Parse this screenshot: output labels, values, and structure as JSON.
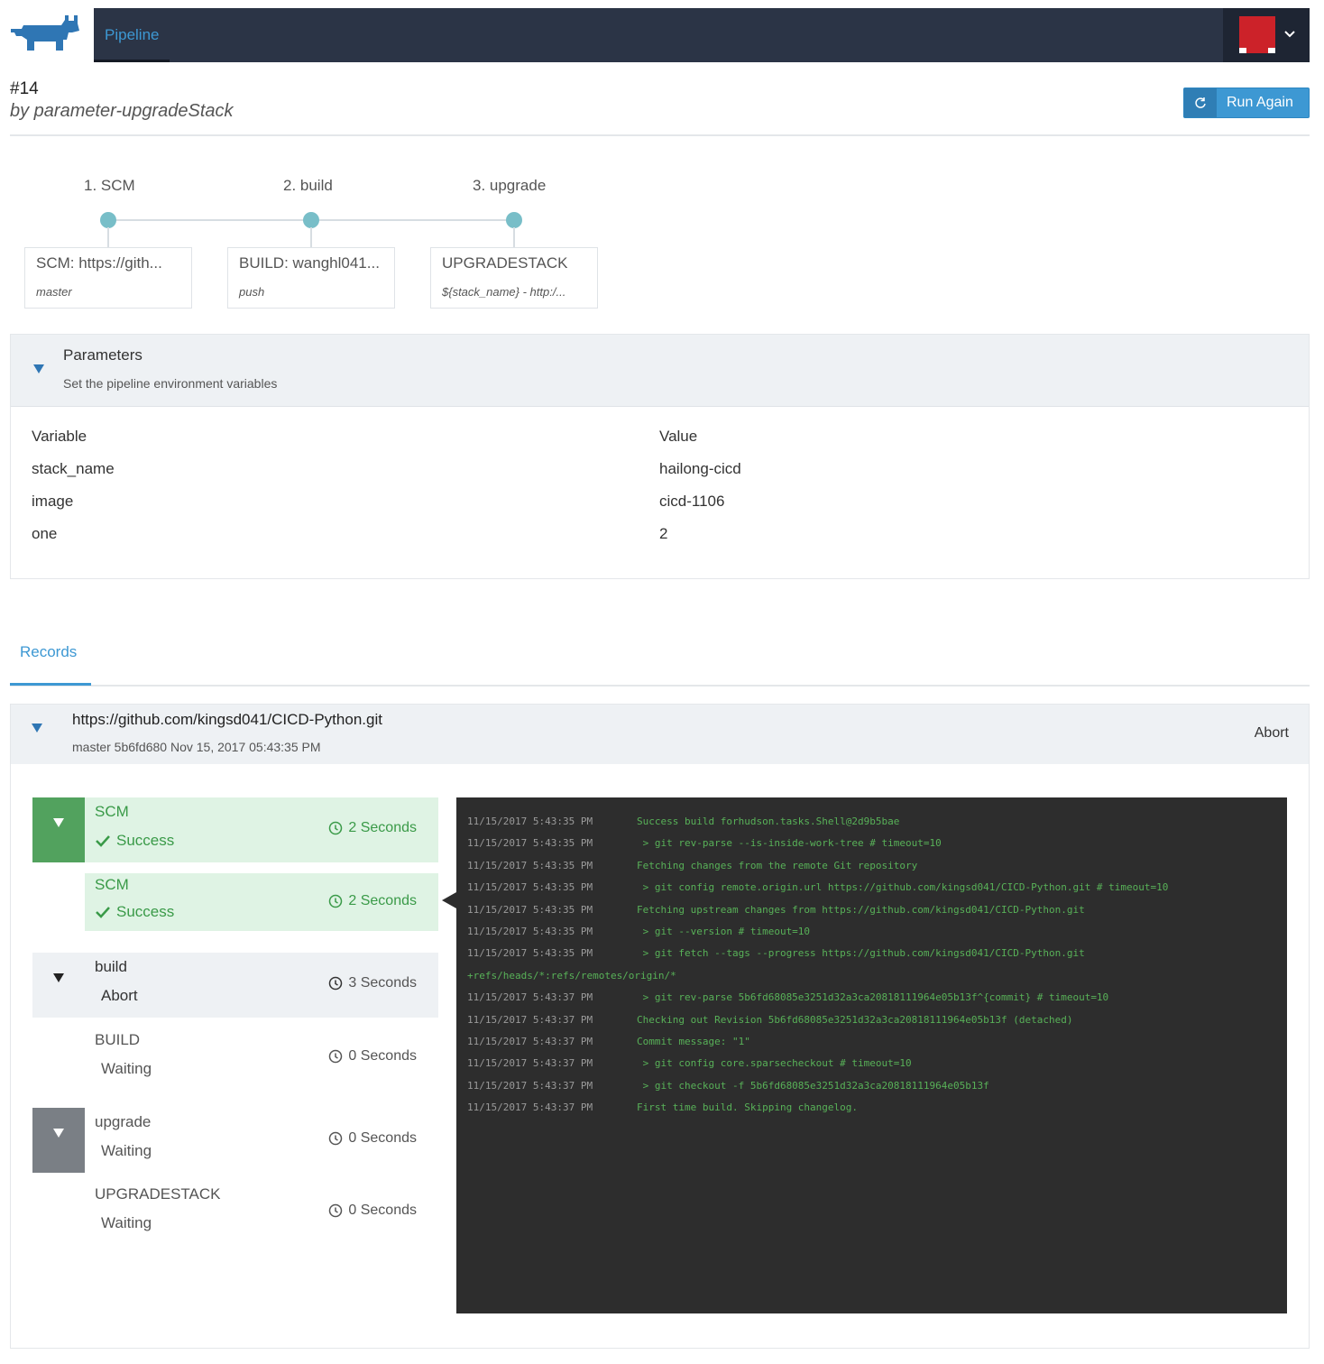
{
  "header": {
    "logo_icon": "rancher-cow-logo",
    "tab_label": "Pipeline",
    "user_menu_icon": "chevron-down-icon",
    "brand_color": "#3d98d3"
  },
  "run": {
    "number": "#14",
    "by": "by parameter-upgradeStack",
    "run_again_label": "Run Again",
    "run_again_icon": "refresh-icon"
  },
  "stages": [
    {
      "title": "1. SCM",
      "card_name": "SCM: https://gith...",
      "card_sub": "master"
    },
    {
      "title": "2. build",
      "card_name": "BUILD: wanghl041...",
      "card_sub": "push"
    },
    {
      "title": "3. upgrade",
      "card_name": "UPGRADESTACK",
      "card_sub": "${stack_name} - http:/..."
    }
  ],
  "parameters": {
    "title": "Parameters",
    "description": "Set the pipeline environment variables",
    "header_key": "Variable",
    "header_value": "Value",
    "rows": [
      {
        "key": "stack_name",
        "value": "hailong-cicd"
      },
      {
        "key": "image",
        "value": "cicd-1106"
      },
      {
        "key": "one",
        "value": "2"
      }
    ]
  },
  "records": {
    "tab_label": "Records",
    "record": {
      "repo": "https://github.com/kingsd041/CICD-Python.git",
      "meta": "master 5b6fd680 Nov 15, 2017 05:43:35 PM",
      "abort_label": "Abort"
    },
    "steps": [
      {
        "name": "SCM",
        "status": "Success",
        "duration": "2 Seconds"
      },
      {
        "name": "SCM",
        "status": "Success",
        "duration": "2 Seconds"
      },
      {
        "name": "build",
        "status": "Abort",
        "duration": "3 Seconds"
      },
      {
        "name": "BUILD",
        "status": "Waiting",
        "duration": "0 Seconds"
      },
      {
        "name": "upgrade",
        "status": "Waiting",
        "duration": "0 Seconds"
      },
      {
        "name": "UPGRADESTACK",
        "status": "Waiting",
        "duration": "0 Seconds"
      }
    ]
  },
  "log": [
    {
      "ts": "11/15/2017 5:43:35 PM",
      "msg": "Success build forhudson.tasks.Shell@2d9b5bae"
    },
    {
      "ts": "11/15/2017 5:43:35 PM",
      "msg": " > git rev-parse --is-inside-work-tree # timeout=10"
    },
    {
      "ts": "11/15/2017 5:43:35 PM",
      "msg": "Fetching changes from the remote Git repository"
    },
    {
      "ts": "11/15/2017 5:43:35 PM",
      "msg": " > git config remote.origin.url https://github.com/kingsd041/CICD-Python.git # timeout=10"
    },
    {
      "ts": "11/15/2017 5:43:35 PM",
      "msg": "Fetching upstream changes from https://github.com/kingsd041/CICD-Python.git"
    },
    {
      "ts": "11/15/2017 5:43:35 PM",
      "msg": " > git --version # timeout=10"
    },
    {
      "ts": "11/15/2017 5:43:35 PM",
      "msg": " > git fetch --tags --progress https://github.com/kingsd041/CICD-Python.git"
    },
    {
      "ts": "",
      "msg": "+refs/heads/*:refs/remotes/origin/*"
    },
    {
      "ts": "11/15/2017 5:43:37 PM",
      "msg": " > git rev-parse 5b6fd68085e3251d32a3ca20818111964e05b13f^{commit} # timeout=10"
    },
    {
      "ts": "11/15/2017 5:43:37 PM",
      "msg": "Checking out Revision 5b6fd68085e3251d32a3ca20818111964e05b13f (detached)"
    },
    {
      "ts": "11/15/2017 5:43:37 PM",
      "msg": "Commit message: \"1\""
    },
    {
      "ts": "11/15/2017 5:43:37 PM",
      "msg": " > git config core.sparsecheckout # timeout=10"
    },
    {
      "ts": "11/15/2017 5:43:37 PM",
      "msg": " > git checkout -f 5b6fd68085e3251d32a3ca20818111964e05b13f"
    },
    {
      "ts": "11/15/2017 5:43:37 PM",
      "msg": "First time build. Skipping changelog."
    }
  ]
}
